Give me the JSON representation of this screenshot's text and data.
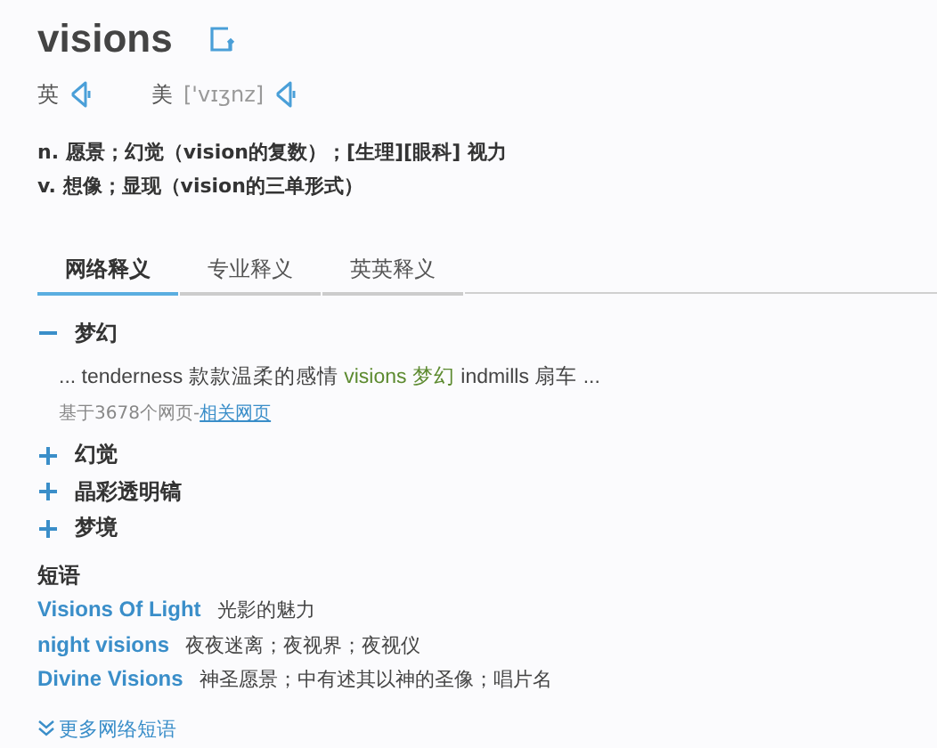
{
  "word": "visions",
  "pronunciations": [
    {
      "region": "英"
    },
    {
      "region": "美",
      "phonetic": "['vɪʒnz]"
    }
  ],
  "definitions": [
    "n. 愿景；幻觉（vision的复数）；[生理][眼科] 视力",
    "v. 想像；显现（vision的三单形式）"
  ],
  "tabs": [
    {
      "label": "网络释义",
      "selected": true
    },
    {
      "label": "专业释义",
      "selected": false
    },
    {
      "label": "英英释义",
      "selected": false
    }
  ],
  "senses": [
    {
      "term": "梦幻",
      "expanded": true,
      "example": {
        "before": "... tenderness 款款温柔的感情 ",
        "highlight": "visions 梦幻",
        "after": " indmills 扇车 ..."
      },
      "source": "基于3678个网页-",
      "source_link": "相关网页"
    },
    {
      "term": "幻觉",
      "expanded": false
    },
    {
      "term": "晶彩透明镐",
      "expanded": false
    },
    {
      "term": "梦境",
      "expanded": false
    }
  ],
  "phrases_heading": "短语",
  "phrases": [
    {
      "phrase": "Visions Of Light",
      "meaning": "光影的魅力"
    },
    {
      "phrase": "night visions",
      "meaning": "夜夜迷离；夜视界；夜视仪"
    },
    {
      "phrase": "Divine Visions",
      "meaning": "神圣愿景；中有述其以神的圣像；唱片名"
    }
  ],
  "more_link": "更多网络短语"
}
